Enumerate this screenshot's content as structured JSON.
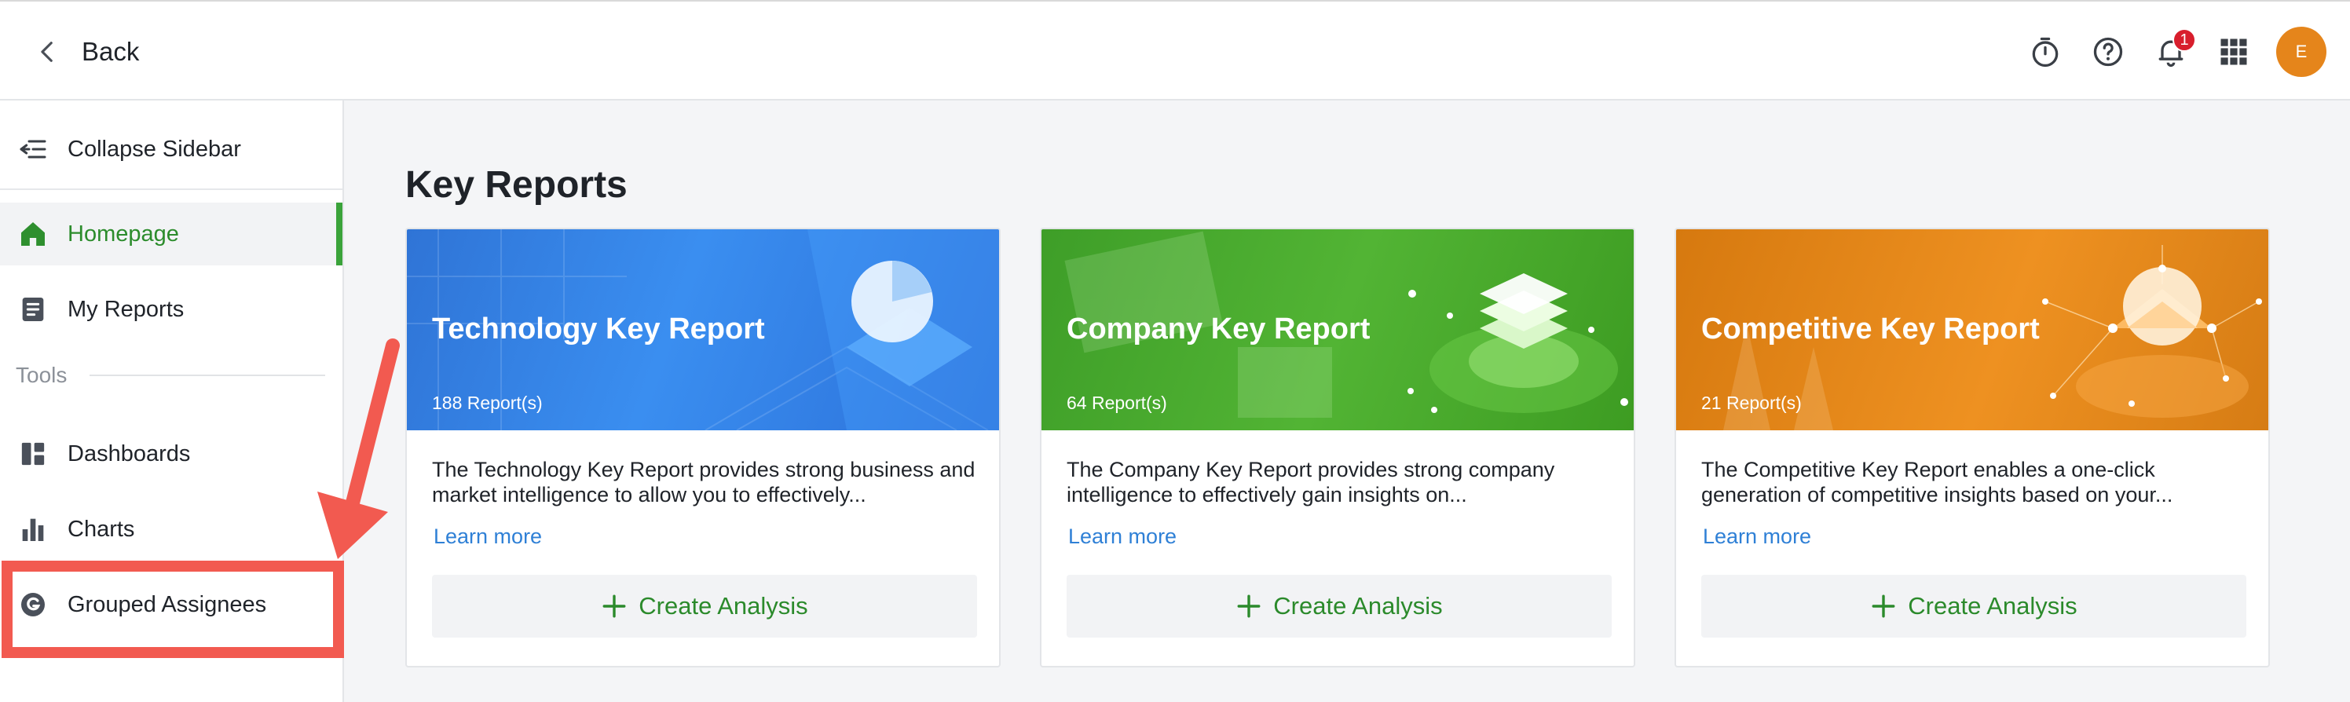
{
  "header": {
    "back_label": "Back",
    "notification_count": "1",
    "avatar_initial": "E"
  },
  "sidebar": {
    "collapse_label": "Collapse Sidebar",
    "items": [
      {
        "label": "Homepage"
      },
      {
        "label": "My Reports"
      }
    ],
    "tools_label": "Tools",
    "tools": [
      {
        "label": "Dashboards"
      },
      {
        "label": "Charts"
      },
      {
        "label": "Grouped Assignees"
      }
    ]
  },
  "main": {
    "title": "Key Reports",
    "cards": [
      {
        "title": "Technology Key Report",
        "count": "188 Report(s)",
        "description": "The Technology Key Report provides strong business and market intelligence to allow you to effectively...",
        "learn_more": "Learn more",
        "action": "Create Analysis"
      },
      {
        "title": "Company Key Report",
        "count": "64 Report(s)",
        "description": "The Company Key Report provides strong company intelligence to effectively gain insights on...",
        "learn_more": "Learn more",
        "action": "Create Analysis"
      },
      {
        "title": "Competitive Key Report",
        "count": "21 Report(s)",
        "description": "The Competitive Key Report enables a one-click generation of competitive insights based on your...",
        "learn_more": "Learn more",
        "action": "Create Analysis"
      }
    ]
  },
  "colors": {
    "accent_green": "#3aa33a",
    "link_blue": "#2f80d6",
    "highlight_red": "#f25a50",
    "tech_blue": "#3a8ef0",
    "company_green": "#52b434",
    "competitive_orange": "#ee9121"
  }
}
